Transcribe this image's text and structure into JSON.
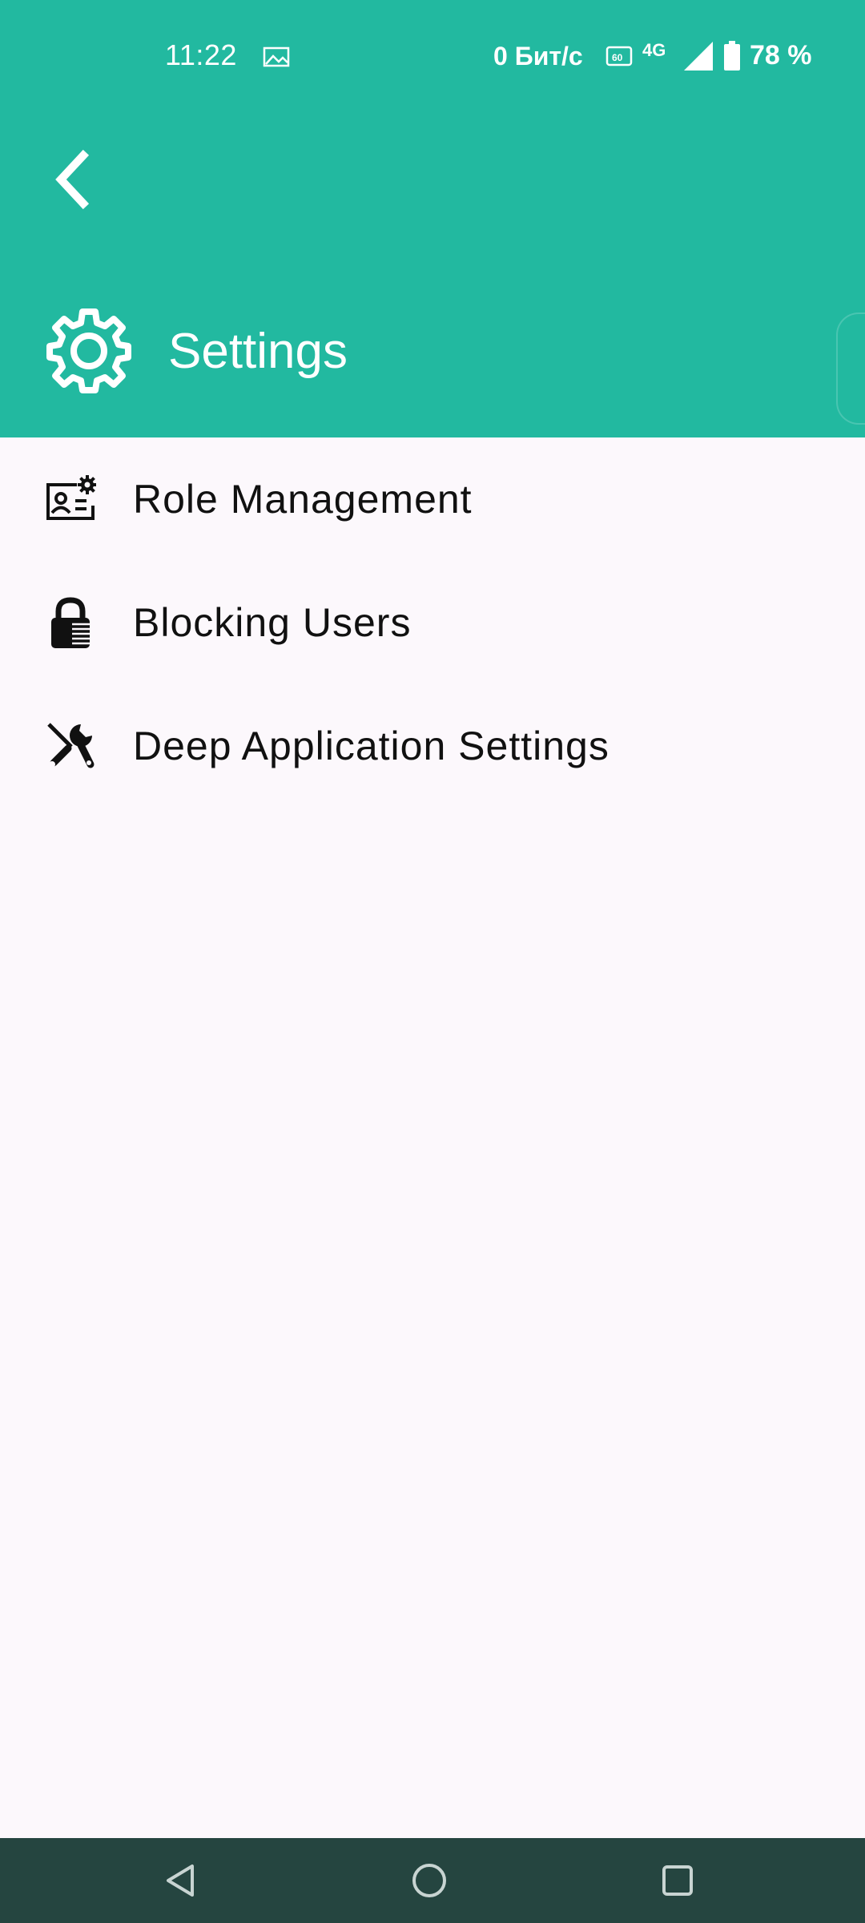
{
  "status_bar": {
    "time": "11:22",
    "network_speed": "0 Бит/с",
    "network_type": "4G",
    "battery": "78 %",
    "icons": [
      "image-icon",
      "refresh-rate-icon",
      "signal-icon",
      "battery-icon"
    ]
  },
  "header": {
    "title": "Settings",
    "icons": [
      "back-arrow-icon",
      "gear-icon"
    ],
    "color": "#22B9A0"
  },
  "menu": {
    "items": [
      {
        "label": "Role Management",
        "icon": "id-card-gear-icon"
      },
      {
        "label": "Blocking Users",
        "icon": "lock-icon"
      },
      {
        "label": "Deep Application Settings",
        "icon": "tools-icon"
      }
    ]
  },
  "nav_bar": {
    "icons": [
      "back-triangle-icon",
      "home-circle-icon",
      "recents-square-icon"
    ],
    "color": "#254540"
  }
}
